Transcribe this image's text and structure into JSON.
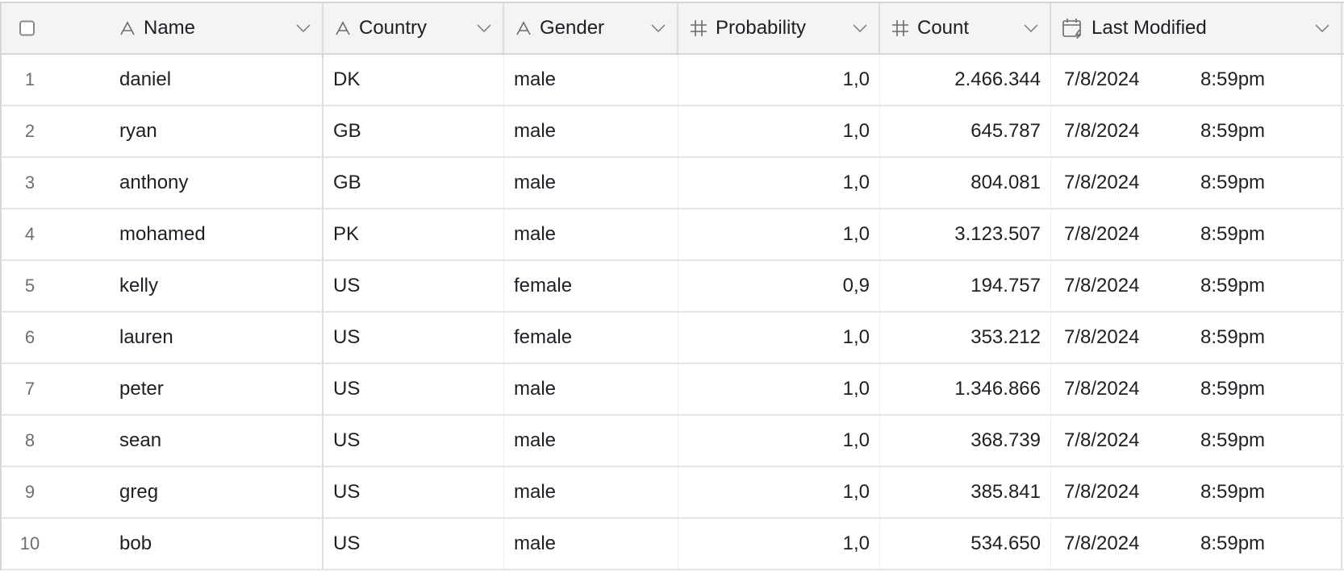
{
  "table": {
    "select_all_checked": false,
    "columns": [
      {
        "key": "name",
        "label": "Name",
        "type": "text",
        "icon": "text-field-icon"
      },
      {
        "key": "country",
        "label": "Country",
        "type": "text",
        "icon": "text-field-icon"
      },
      {
        "key": "gender",
        "label": "Gender",
        "type": "text",
        "icon": "text-field-icon"
      },
      {
        "key": "probability",
        "label": "Probability",
        "type": "number",
        "icon": "number-field-icon"
      },
      {
        "key": "count",
        "label": "Count",
        "type": "number",
        "icon": "number-field-icon"
      },
      {
        "key": "last_modified",
        "label": "Last Modified",
        "type": "last-modified-time",
        "icon": "calendar-lightning-icon"
      }
    ],
    "rows": [
      {
        "num": "1",
        "name": "daniel",
        "country": "DK",
        "gender": "male",
        "probability": "1,0",
        "count": "2.466.344",
        "date": "7/8/2024",
        "time": "8:59pm"
      },
      {
        "num": "2",
        "name": "ryan",
        "country": "GB",
        "gender": "male",
        "probability": "1,0",
        "count": "645.787",
        "date": "7/8/2024",
        "time": "8:59pm"
      },
      {
        "num": "3",
        "name": "anthony",
        "country": "GB",
        "gender": "male",
        "probability": "1,0",
        "count": "804.081",
        "date": "7/8/2024",
        "time": "8:59pm"
      },
      {
        "num": "4",
        "name": "mohamed",
        "country": "PK",
        "gender": "male",
        "probability": "1,0",
        "count": "3.123.507",
        "date": "7/8/2024",
        "time": "8:59pm"
      },
      {
        "num": "5",
        "name": "kelly",
        "country": "US",
        "gender": "female",
        "probability": "0,9",
        "count": "194.757",
        "date": "7/8/2024",
        "time": "8:59pm"
      },
      {
        "num": "6",
        "name": "lauren",
        "country": "US",
        "gender": "female",
        "probability": "1,0",
        "count": "353.212",
        "date": "7/8/2024",
        "time": "8:59pm"
      },
      {
        "num": "7",
        "name": "peter",
        "country": "US",
        "gender": "male",
        "probability": "1,0",
        "count": "1.346.866",
        "date": "7/8/2024",
        "time": "8:59pm"
      },
      {
        "num": "8",
        "name": "sean",
        "country": "US",
        "gender": "male",
        "probability": "1,0",
        "count": "368.739",
        "date": "7/8/2024",
        "time": "8:59pm"
      },
      {
        "num": "9",
        "name": "greg",
        "country": "US",
        "gender": "male",
        "probability": "1,0",
        "count": "385.841",
        "date": "7/8/2024",
        "time": "8:59pm"
      },
      {
        "num": "10",
        "name": "bob",
        "country": "US",
        "gender": "male",
        "probability": "1,0",
        "count": "534.650",
        "date": "7/8/2024",
        "time": "8:59pm"
      }
    ]
  }
}
